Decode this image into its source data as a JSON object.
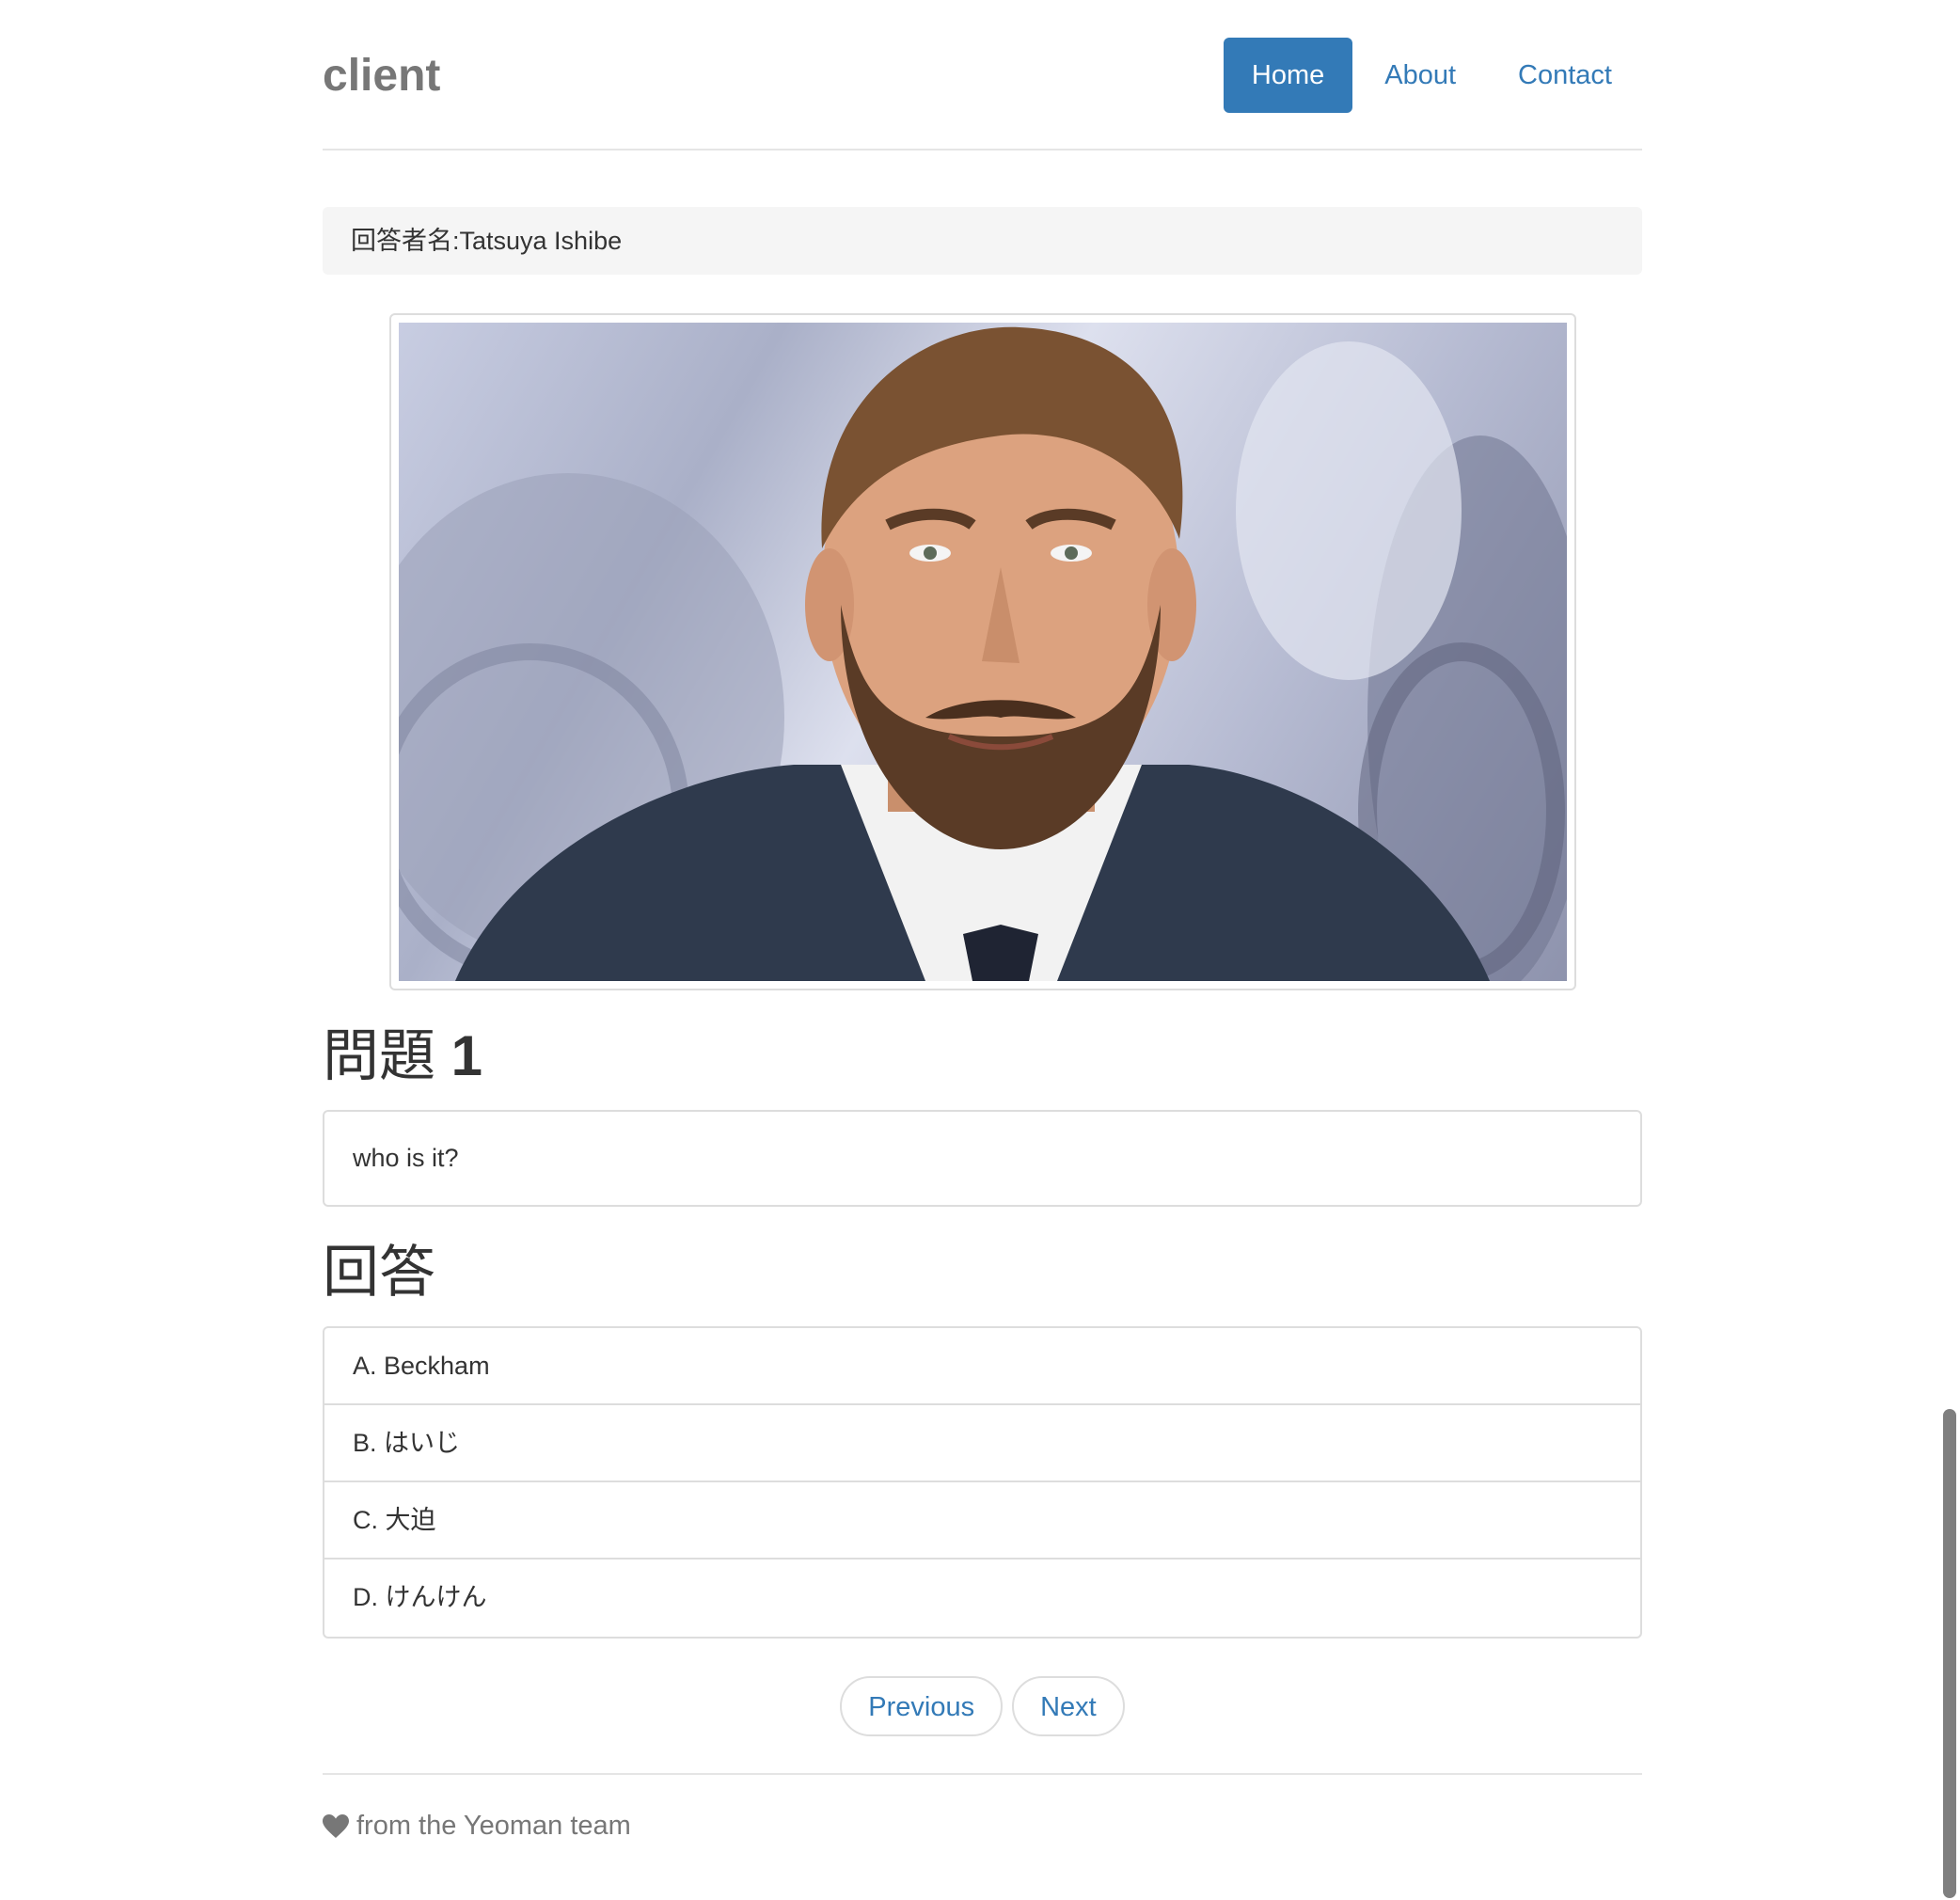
{
  "header": {
    "brand": "client",
    "nav": [
      {
        "label": "Home",
        "active": true
      },
      {
        "label": "About",
        "active": false
      },
      {
        "label": "Contact",
        "active": false
      }
    ]
  },
  "respondent": {
    "label": "回答者名:Tatsuya Ishibe"
  },
  "question": {
    "heading_prefix": "問題",
    "number": "1",
    "text": "who is it?"
  },
  "answer": {
    "heading": "回答",
    "options": [
      "A. Beckham",
      "B. はいじ",
      "C. 大迫",
      "D. けんけん"
    ]
  },
  "pager": {
    "previous": "Previous",
    "next": "Next"
  },
  "footer": {
    "text": "from the Yeoman team",
    "icon": "heart-icon"
  },
  "colors": {
    "primary": "#337ab7",
    "muted": "#777777",
    "border": "#dddddd",
    "well_bg": "#f5f5f5"
  }
}
